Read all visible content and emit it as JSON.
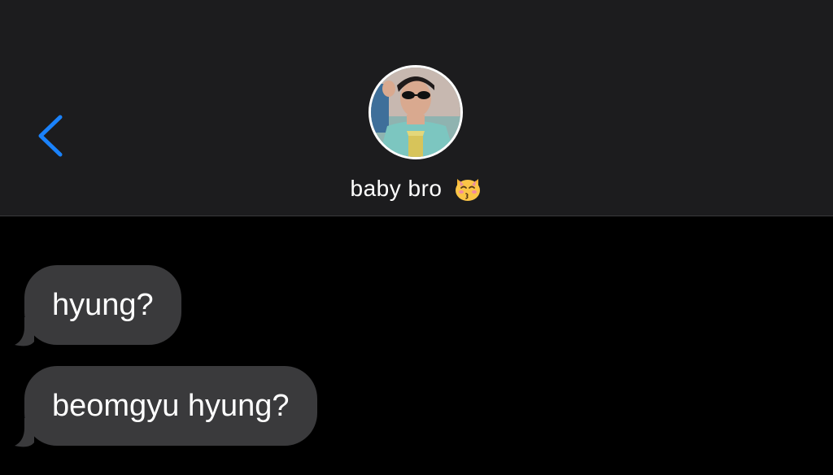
{
  "header": {
    "contact_name": "baby bro",
    "contact_emoji": "kissing-cat-emoji",
    "back_icon": "chevron-left-icon",
    "accent_color": "#1a82fb"
  },
  "messages": [
    {
      "direction": "incoming",
      "text": "hyung?"
    },
    {
      "direction": "incoming",
      "text": "beomgyu hyung?"
    }
  ],
  "colors": {
    "header_background": "#1c1c1e",
    "chat_background": "#000000",
    "incoming_bubble": "#3a3a3c",
    "text": "#ffffff"
  }
}
